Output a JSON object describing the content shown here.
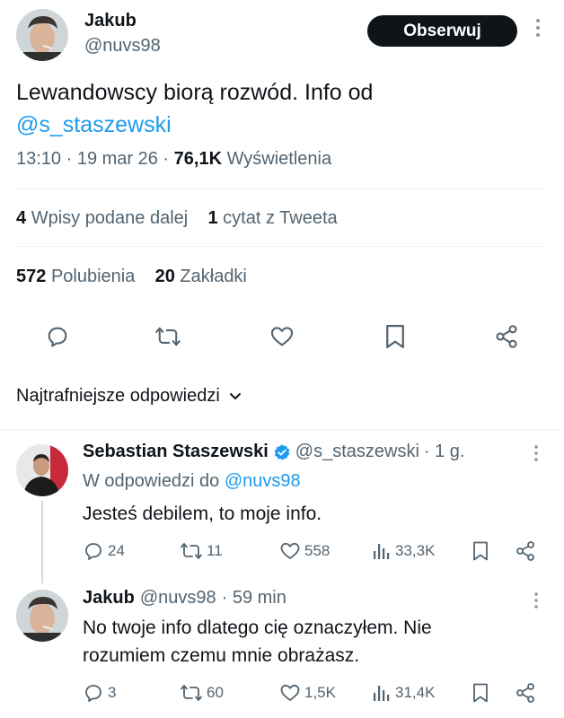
{
  "tweet": {
    "author_name": "Jakub",
    "author_handle": "@nuvs98",
    "follow_label": "Obserwuj",
    "text_main": "Lewandowscy biorą rozwód. Info od",
    "mention": "@s_staszewski",
    "time": "13:10 · 19 mar 26 ·",
    "views_count": "76,1K",
    "views_label": "Wyświetlenia",
    "reposts_count": "4",
    "reposts_label": "Wpisy podane dalej",
    "quotes_count": "1",
    "quotes_label": "cytat z Tweeta",
    "likes_count": "572",
    "likes_label": "Polubienia",
    "bookmarks_count": "20",
    "bookmarks_label": "Zakładki"
  },
  "sort": {
    "label": "Najtrafniejsze odpowiedzi"
  },
  "replies": [
    {
      "name": "Sebastian Staszewski",
      "handle": "@s_staszewski",
      "time": "· 1 g.",
      "reply_to_prefix": "W odpowiedzi do",
      "reply_to_handle": "@nuvs98",
      "text": "Jesteś debilem, to moje info.",
      "comments": "24",
      "reposts": "11",
      "likes": "558",
      "views": "33,3K"
    },
    {
      "name": "Jakub",
      "handle": "@nuvs98",
      "time": "· 59 min",
      "text_line1": "No twoje info dlatego cię oznaczyłem. Nie",
      "text_line2": "rozumiem czemu mnie obrażasz.",
      "comments": "3",
      "reposts": "60",
      "likes": "1,5K",
      "views": "31,4K"
    }
  ],
  "colors": {
    "accent": "#1d9bf0",
    "text": "#0f1419",
    "muted": "#536471"
  }
}
